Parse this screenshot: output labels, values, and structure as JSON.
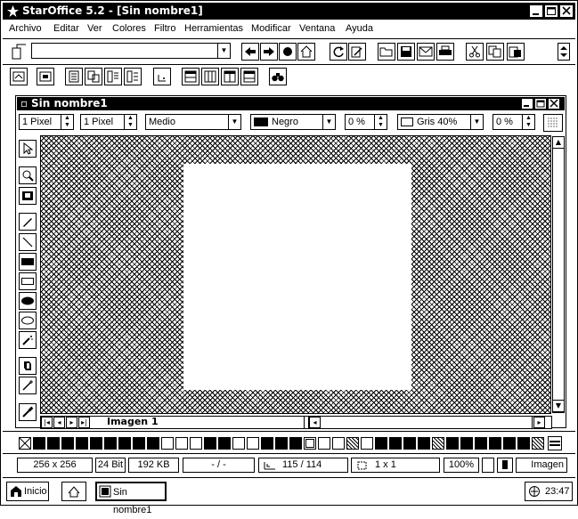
{
  "window": {
    "title": "StarOffice 5.2 - [Sin nombre1]"
  },
  "menu": [
    {
      "label": "Archivo"
    },
    {
      "label": "Editar"
    },
    {
      "label": "Ver"
    },
    {
      "label": "Colores"
    },
    {
      "label": "Filtro"
    },
    {
      "label": "Herramientas"
    },
    {
      "label": "Modificar"
    },
    {
      "label": "Ventana"
    },
    {
      "label": "Ayuda"
    }
  ],
  "url_bar": {
    "value": ""
  },
  "document": {
    "title": "Sin nombre1",
    "tab_label": "Imagen 1"
  },
  "props_bar": {
    "line_width_1": "1 Pixel",
    "line_width_2": "1 Pixel",
    "quality": "Medio",
    "color": "Negro",
    "transparency_1": "0 %",
    "fill": "Gris 40%",
    "transparency_2": "0 %"
  },
  "status": {
    "size": "256 x 256",
    "depth": "24 Bit",
    "memory": "192 KB",
    "page": "- / -",
    "position": "115 / 114",
    "selection": "1 x 1",
    "zoom": "100%",
    "mode": "Imagen"
  },
  "taskbar": {
    "start": "Inicio",
    "task": "Sin nombre1",
    "clock": "23:47"
  }
}
